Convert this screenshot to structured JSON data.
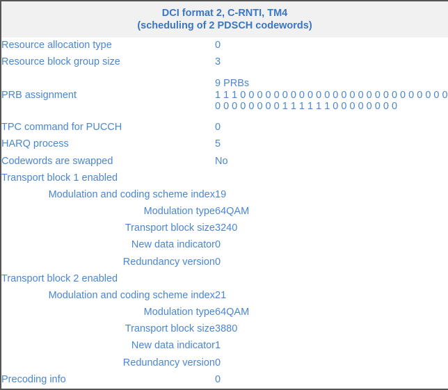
{
  "header": {
    "title_line1": "DCI format 2, C-RNTI, TM4",
    "title_line2": "(scheduling of 2 PDSCH codewords)"
  },
  "colors": {
    "text_blue": "#4a86d0",
    "header_blue": "#3a76c4",
    "header_bg": "#f1f1f1",
    "grid_line": "#d8d8d8",
    "outer_border": "#555555"
  },
  "rows": [
    {
      "label": "Resource allocation type",
      "value": "0",
      "type": "normal"
    },
    {
      "label": "Resource block group size",
      "value": "3",
      "type": "normal"
    },
    {
      "label": "PRB assignment",
      "type": "prb",
      "prb_count": "9 PRBs",
      "prb_bits": "1 1 1 0 0 0 0 0 0 0 0 0 0 0 0 0 0 0 0 0 0 0 0 0 0 0 0 0 0 0 0 0 0 0 0 0 1 1 1 1 1 1 0 0 0 0 0 0 0 0"
    },
    {
      "label": "TPC command for PUCCH",
      "value": "0",
      "type": "normal"
    },
    {
      "label": "HARQ process",
      "value": "5",
      "type": "normal"
    },
    {
      "label": "Codewords are swapped",
      "value": "No",
      "type": "normal"
    },
    {
      "label": "Transport block 1 enabled",
      "value": "",
      "type": "group"
    },
    {
      "label": "Modulation and coding scheme index",
      "value": "19",
      "type": "sub"
    },
    {
      "label": "Modulation type",
      "value": "64QAM",
      "type": "sub"
    },
    {
      "label": "Transport block size",
      "value": "3240",
      "type": "sub"
    },
    {
      "label": "New data indicator",
      "value": "0",
      "type": "sub"
    },
    {
      "label": "Redundancy version",
      "value": "0",
      "type": "sub"
    },
    {
      "label": "Transport block 2 enabled",
      "value": "",
      "type": "group"
    },
    {
      "label": "Modulation and coding scheme index",
      "value": "21",
      "type": "sub"
    },
    {
      "label": "Modulation type",
      "value": "64QAM",
      "type": "sub"
    },
    {
      "label": "Transport block size",
      "value": "3880",
      "type": "sub"
    },
    {
      "label": "New data indicator",
      "value": "1",
      "type": "sub"
    },
    {
      "label": "Redundancy version",
      "value": "0",
      "type": "sub"
    },
    {
      "label": "Precoding info",
      "value": "0",
      "type": "normal"
    }
  ]
}
